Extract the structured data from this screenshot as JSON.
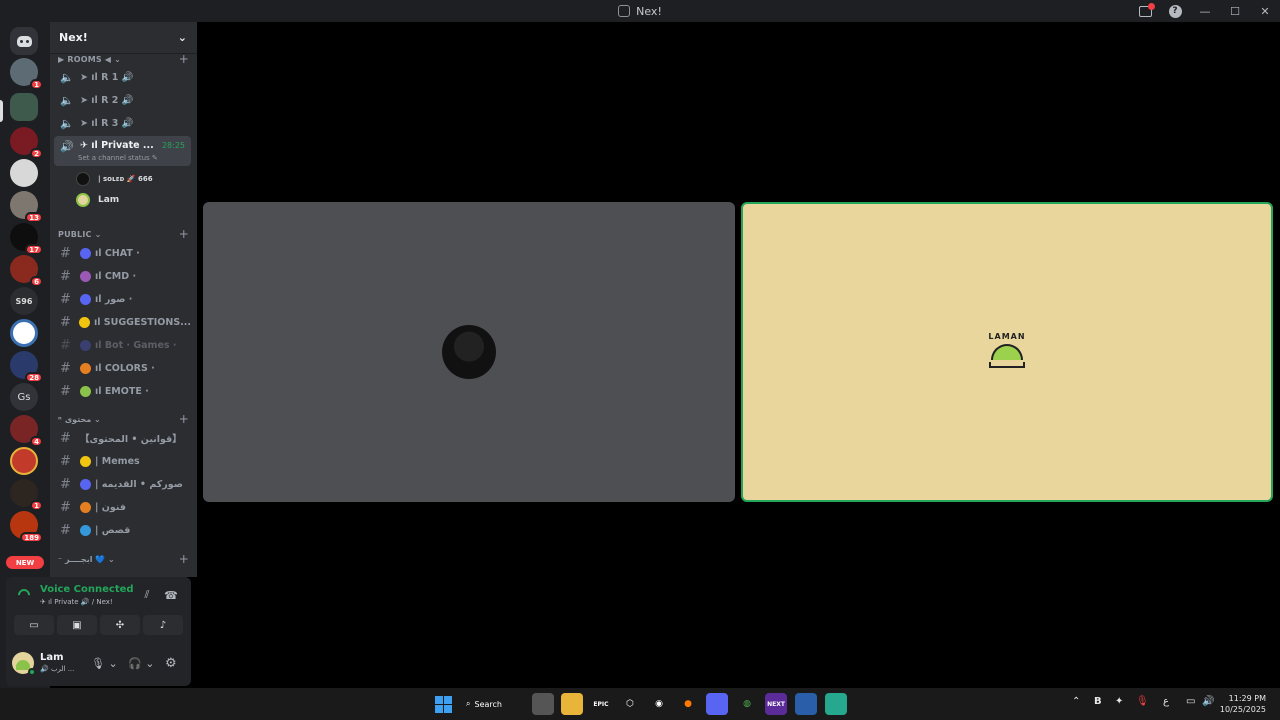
{
  "window": {
    "title": "Nex!",
    "help_label": "?",
    "minimize": "—",
    "maximize": "☐",
    "close": "✕"
  },
  "server_rail": {
    "badges": [
      "1",
      "2",
      "13",
      "17",
      "6",
      "28",
      "4",
      "1",
      "189"
    ],
    "gs_label": "Gs",
    "s96_label": "S96",
    "new_label": "NEW"
  },
  "sidebar": {
    "guild_name": "Nex!",
    "categories": {
      "rooms": "▶ ROOMS ◀ ⌄",
      "public": "PUBLIC ⌄",
      "content": "ⁿ محتوى ⌄",
      "misc": "⁻ ابجــــر 💙 ⌄"
    },
    "voice_channels": [
      {
        "name": "➤ ıl R 1 🔊"
      },
      {
        "name": "➤ ıl R 2 🔊"
      },
      {
        "name": "➤ ıl R 3 🔊"
      }
    ],
    "active_channel": {
      "name": "✈ ıl Private ...",
      "timer": "28:25",
      "status": "Set a channel status ✎"
    },
    "voice_users": [
      {
        "name": "| ꜱᴏʟᴇᴅ  🚀 666"
      },
      {
        "name": "Lam"
      }
    ],
    "public_channels": [
      {
        "name": "ıl CHAT ·",
        "color": "#5865f2"
      },
      {
        "name": "ıl CMD ·",
        "color": "#9b59b6"
      },
      {
        "name": "ıl صور ·",
        "color": "#5865f2"
      },
      {
        "name": "ıl SUGGESTIONS...",
        "color": "#f1c40f"
      },
      {
        "name": "ıl Bot · Games ·",
        "color": "#5865f2",
        "muted": true
      },
      {
        "name": "ıl COLORS ·",
        "color": "#e67e22"
      },
      {
        "name": "ıl EMOTE ·",
        "color": "#8bc34a"
      }
    ],
    "content_channels": [
      {
        "name": "【قوانين • المحتوى】",
        "color": ""
      },
      {
        "name": "| Memes",
        "color": "#f1c40f"
      },
      {
        "name": "| صوركم • القديمه",
        "color": "#5865f2"
      },
      {
        "name": "| فنون",
        "color": "#e67e22"
      },
      {
        "name": "| قصص",
        "color": "#3498db"
      }
    ]
  },
  "voice_panel": {
    "title": "Voice Connected",
    "subtitle": "✈ ıl Private 🔊 / Nex!"
  },
  "user_panel": {
    "name": "Lam",
    "status": "🔊 الرب ..."
  },
  "stage": {
    "tile_b_logo_text": "LAMAN"
  },
  "taskbar": {
    "search_label": "Search",
    "time": "11:29 PM",
    "date": "10/25/2025",
    "lang": "ع",
    "apps": [
      "EPIC",
      "NEXT"
    ]
  }
}
